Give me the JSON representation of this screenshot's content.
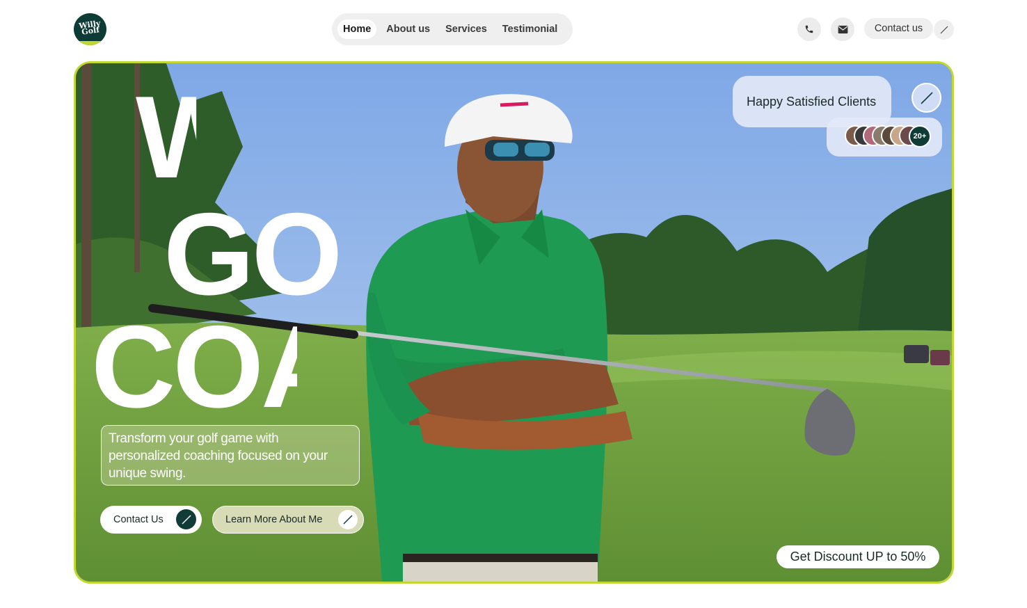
{
  "header": {
    "logo_text": "Willy Golf",
    "nav": [
      {
        "label": "Home",
        "active": true
      },
      {
        "label": "About us",
        "active": false
      },
      {
        "label": "Services",
        "active": false
      },
      {
        "label": "Testimonial",
        "active": false
      }
    ],
    "phone_icon": "phone-icon",
    "mail_icon": "mail-icon",
    "contact_label": "Contact us",
    "contact_arrow_icon": "arrow-up-right-icon"
  },
  "hero": {
    "headline_lines": [
      "WILLY",
      "GOLF",
      "COACH"
    ],
    "tagline": "Transform your golf game with personalized coaching focused on your unique swing.",
    "primary_cta": "Contact Us",
    "secondary_cta": "Learn More About Me",
    "clients_label": "Happy Satisfied Clients",
    "clients_count": "20+",
    "discount": "Get Discount UP to 50%"
  },
  "colors": {
    "brand_dark": "#0f3c37",
    "accent_lime": "#c2d832",
    "shirt_green": "#1e9a52",
    "sky": "#8fb6ea"
  }
}
